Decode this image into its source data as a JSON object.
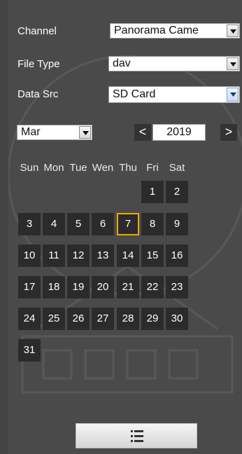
{
  "filters": {
    "channel": {
      "label": "Channel",
      "value": "Panorama Came"
    },
    "file_type": {
      "label": "File Type",
      "value": "dav"
    },
    "data_src": {
      "label": "Data Src",
      "value": "SD Card"
    }
  },
  "calendar": {
    "month": "Mar",
    "year": "2019",
    "prev_symbol": "<",
    "next_symbol": ">",
    "weekdays": [
      "Sun",
      "Mon",
      "Tue",
      "Wen",
      "Thu",
      "Fri",
      "Sat"
    ],
    "days": [
      "1",
      "2",
      "3",
      "4",
      "5",
      "6",
      "7",
      "8",
      "9",
      "10",
      "11",
      "12",
      "13",
      "14",
      "15",
      "16",
      "17",
      "18",
      "19",
      "20",
      "21",
      "22",
      "23",
      "24",
      "25",
      "26",
      "27",
      "28",
      "29",
      "30",
      "31"
    ],
    "selected_day": "7",
    "highlight_color": "#f0a800"
  },
  "bottom": {
    "icon": "list-icon"
  }
}
